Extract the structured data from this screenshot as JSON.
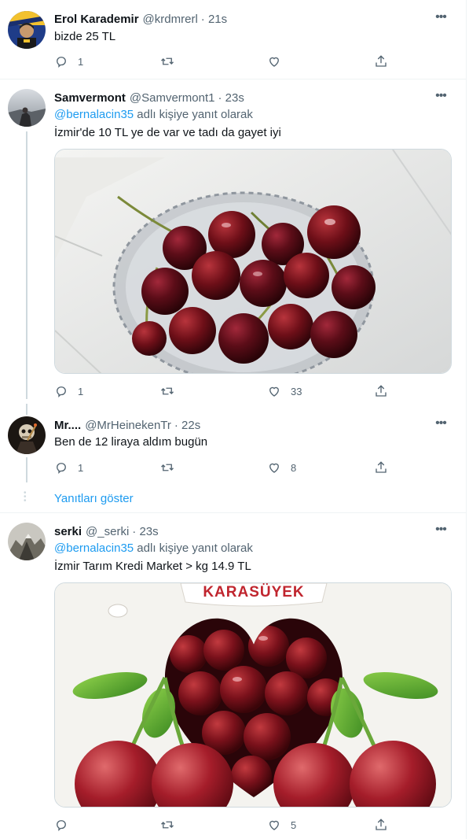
{
  "tweets": [
    {
      "name": "Erol Karademir",
      "handle": "@krdmrerl",
      "time": "· 21s",
      "text": "bizde 25 TL",
      "reply_count": "1",
      "retweet_count": "",
      "like_count": ""
    },
    {
      "name": "Samvermont",
      "handle": "@Samvermont1",
      "time": "· 23s",
      "replying_mention": "@bernalacin35",
      "replying_suffix": " adlı kişiye yanıt olarak",
      "text": "İzmir'de 10 TL ye de var ve tadı da gayet iyi",
      "reply_count": "1",
      "retweet_count": "",
      "like_count": "33"
    },
    {
      "name": "Mr....",
      "handle": "@MrHeinekenTr",
      "time": "· 22s",
      "text": "Ben de 12 liraya aldım bugün",
      "reply_count": "1",
      "retweet_count": "",
      "like_count": "8"
    },
    {
      "name": "serki",
      "handle": "@_serki",
      "time": "· 23s",
      "replying_mention": "@bernalacin35",
      "replying_suffix": " adlı kişiye yanıt olarak",
      "text": "İzmir Tarım Kredi Market > kg 14.9 TL",
      "reply_count": "",
      "retweet_count": "",
      "like_count": "5"
    }
  ],
  "show_replies_label": "Yanıtları göster",
  "box_brand": "KARASÜYEK",
  "more_glyph": "•••",
  "icons": {
    "reply": "reply-icon",
    "retweet": "retweet-icon",
    "like": "like-icon",
    "share": "share-icon",
    "more": "more-icon"
  },
  "colors": {
    "link": "#1d9bf0",
    "secondary_text": "#536471",
    "primary_text": "#0f1419",
    "divider": "#eff3f4"
  }
}
